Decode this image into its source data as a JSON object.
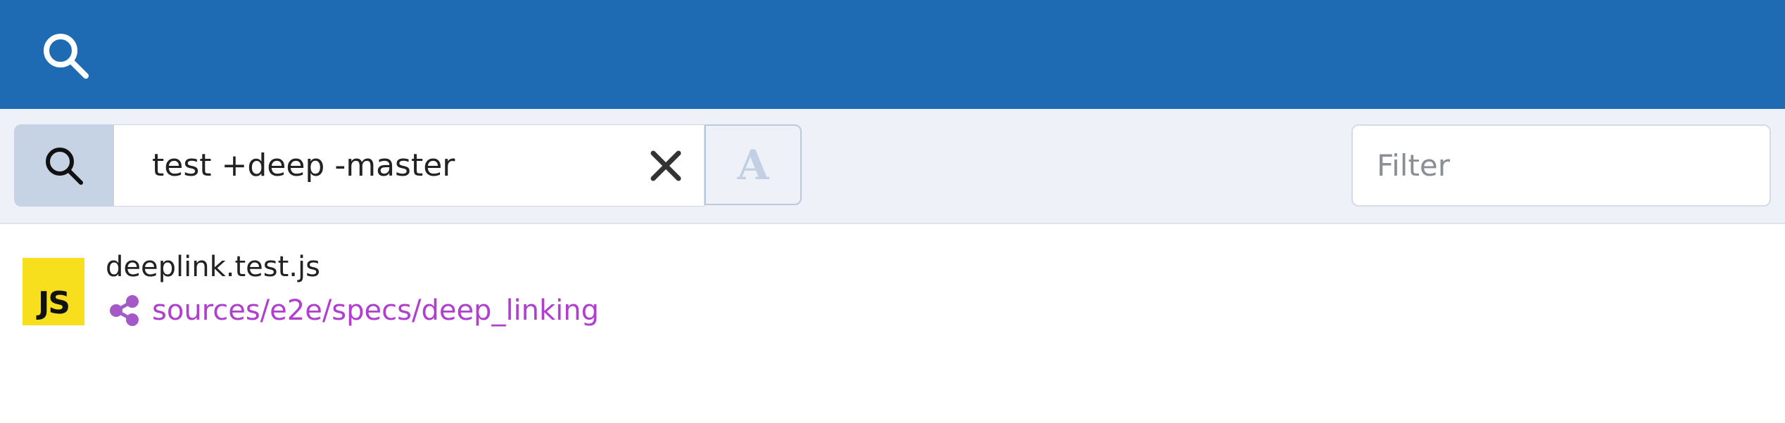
{
  "header": {
    "icon": "search-icon"
  },
  "search": {
    "query": "test +deep -master",
    "clear_icon": "close-icon",
    "case_toggle_label": "A",
    "filter_placeholder": "Filter"
  },
  "results": [
    {
      "badge": "JS",
      "file_name": "deeplink.test.js",
      "path": "sources/e2e/specs/deep_linking",
      "path_icon": "share-icon"
    }
  ],
  "colors": {
    "header_bg": "#1f6bb3",
    "toolbar_bg": "#eef2f8",
    "js_badge": "#f7df1e",
    "path_link": "#b03ecf",
    "share_icon": "#a35ac6"
  }
}
